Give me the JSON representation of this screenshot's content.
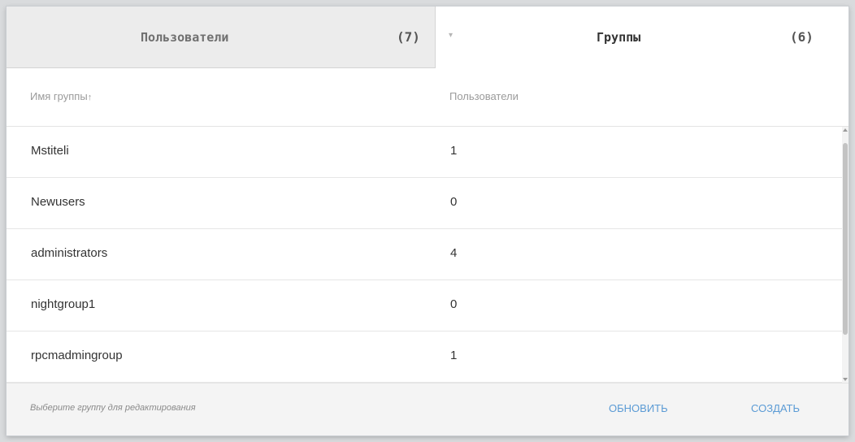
{
  "tabs": [
    {
      "label": "Пользователи",
      "count": "(7)"
    },
    {
      "label": "Группы",
      "count": "(6)",
      "caret": "▾"
    }
  ],
  "table": {
    "columns": {
      "name": "Имя группы",
      "sort_indicator": "↑",
      "users": "Пользователи"
    },
    "rows": [
      {
        "name": "Mstiteli",
        "users": "1"
      },
      {
        "name": "Newusers",
        "users": "0"
      },
      {
        "name": "administrators",
        "users": "4"
      },
      {
        "name": "nightgroup1",
        "users": "0"
      },
      {
        "name": "rpcmadmingroup",
        "users": "1"
      }
    ]
  },
  "footer": {
    "hint": "Выберите группу для редактирования",
    "refresh_label": "ОБНОВИТЬ",
    "create_label": "СОЗДАТЬ"
  },
  "colors": {
    "accent": "#5b9bd5",
    "inactive_tab": "#ececec",
    "footer_bg": "#f4f4f4"
  }
}
